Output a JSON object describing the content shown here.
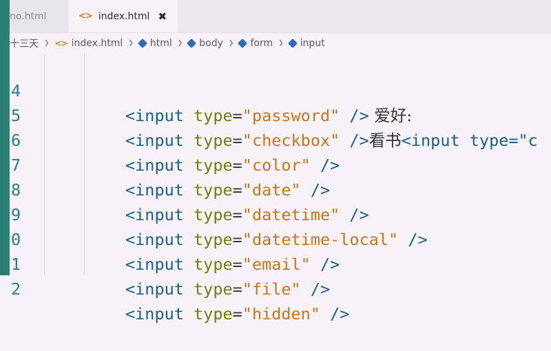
{
  "tabs": [
    {
      "label": "no.html",
      "active": false
    },
    {
      "label": "index.html",
      "active": true,
      "close": "✖"
    }
  ],
  "tab_icon": "<>",
  "breadcrumb": [
    {
      "label": "十三天",
      "icon": ""
    },
    {
      "label": "index.html",
      "icon": "code-icon"
    },
    {
      "label": "html",
      "icon": "cube-icon"
    },
    {
      "label": "body",
      "icon": "cube-icon"
    },
    {
      "label": "form",
      "icon": "cube-icon"
    },
    {
      "label": "input",
      "icon": "cube-icon"
    }
  ],
  "code_lines": [
    {
      "no": "4",
      "open": "<input",
      "attr": " type",
      "eq": "=",
      "val": "\"password\"",
      "close": " />",
      "tail": " 爱好:",
      "tail2": ""
    },
    {
      "no": "5",
      "open": "<input",
      "attr": " type",
      "eq": "=",
      "val": "\"checkbox\"",
      "close": " />",
      "tail": "看书",
      "tail2": "<input type=\"c"
    },
    {
      "no": "6",
      "open": "<input",
      "attr": " type",
      "eq": "=",
      "val": "\"color\"",
      "close": " />",
      "tail": "",
      "tail2": ""
    },
    {
      "no": "7",
      "open": "<input",
      "attr": " type",
      "eq": "=",
      "val": "\"date\"",
      "close": " />",
      "tail": "",
      "tail2": ""
    },
    {
      "no": "8",
      "open": "<input",
      "attr": " type",
      "eq": "=",
      "val": "\"datetime\"",
      "close": " />",
      "tail": "",
      "tail2": ""
    },
    {
      "no": "9",
      "open": "<input",
      "attr": " type",
      "eq": "=",
      "val": "\"datetime-local\"",
      "close": " />",
      "tail": "",
      "tail2": ""
    },
    {
      "no": "0",
      "open": "<input",
      "attr": " type",
      "eq": "=",
      "val": "\"email\"",
      "close": " />",
      "tail": "",
      "tail2": ""
    },
    {
      "no": "1",
      "open": "<input",
      "attr": " type",
      "eq": "=",
      "val": "\"file\"",
      "close": " />",
      "tail": "",
      "tail2": ""
    },
    {
      "no": "2",
      "open": "<input",
      "attr": " type",
      "eq": "=",
      "val": "\"hidden\"",
      "close": " />",
      "tail": "",
      "tail2": ""
    }
  ],
  "colors": {
    "tag": "#1b5f87",
    "attr": "#6d7f14",
    "string": "#c6771e",
    "line_number": "#2a7c95",
    "activity_bar": "#2a7f74"
  }
}
